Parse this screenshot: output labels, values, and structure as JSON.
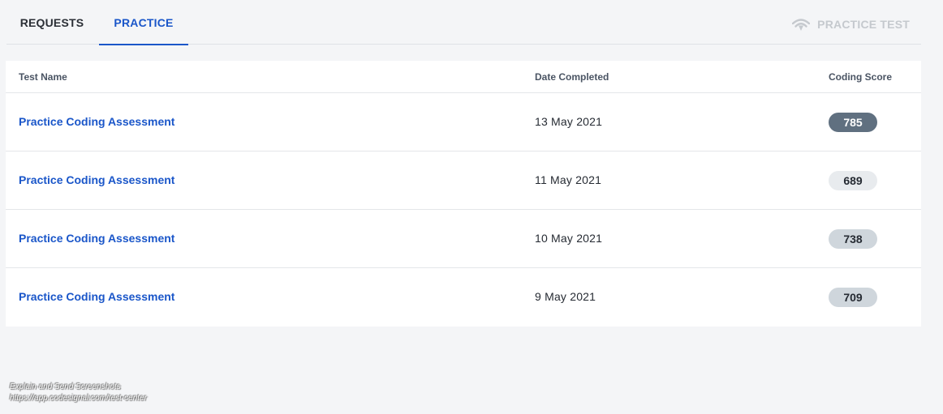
{
  "tabs": [
    {
      "label": "REQUESTS",
      "active": false
    },
    {
      "label": "PRACTICE",
      "active": true
    }
  ],
  "practice_test": {
    "label": "PRACTICE TEST",
    "icon": "signal-icon",
    "color": "#c5c9ce"
  },
  "table": {
    "headers": {
      "name": "Test Name",
      "date": "Date Completed",
      "score": "Coding Score"
    },
    "rows": [
      {
        "name": "Practice Coding Assessment",
        "date": "13 May 2021",
        "score": "785",
        "badge_bg": "#607080",
        "badge_fg": "#ffffff"
      },
      {
        "name": "Practice Coding Assessment",
        "date": "11 May 2021",
        "score": "689",
        "badge_bg": "#e8ebee",
        "badge_fg": "#262b33"
      },
      {
        "name": "Practice Coding Assessment",
        "date": "10 May 2021",
        "score": "738",
        "badge_bg": "#cfd6dc",
        "badge_fg": "#262b33"
      },
      {
        "name": "Practice Coding Assessment",
        "date": "9 May 2021",
        "score": "709",
        "badge_bg": "#cfd6dc",
        "badge_fg": "#262b33"
      }
    ]
  },
  "footer": {
    "line1": "Explain and Send Screenshots",
    "line2": "https://app.codesignal.com/test-center"
  },
  "colors": {
    "accent": "#1a56c9",
    "background": "#f4f5f7"
  }
}
